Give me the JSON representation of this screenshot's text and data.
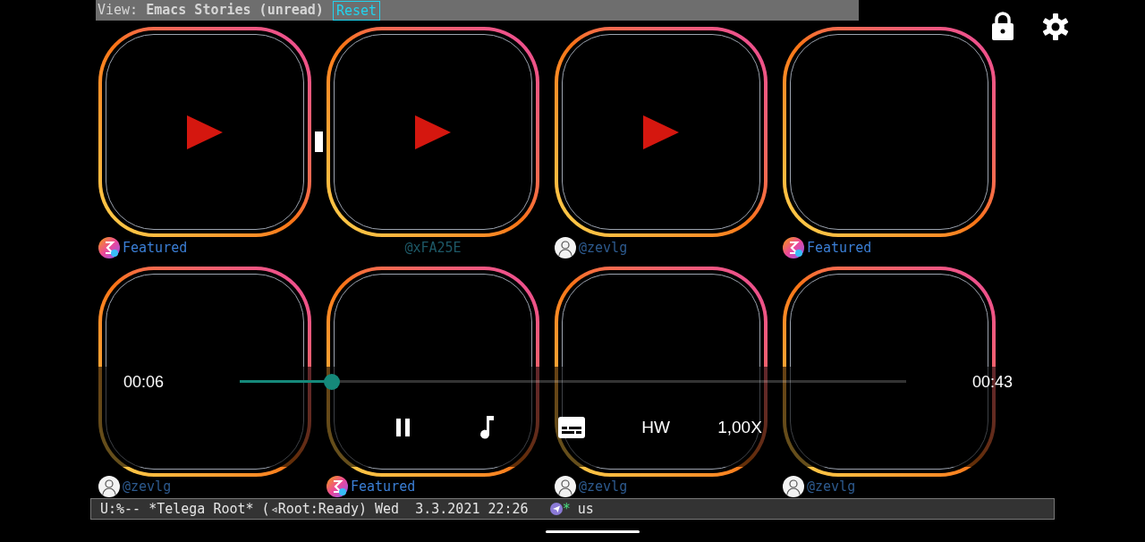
{
  "header": {
    "view_label": "View: **Emacs Stories (unread)**",
    "reset_button": "Reset"
  },
  "stories": [
    {
      "has_play": true,
      "kind": "featured",
      "author": "Featured",
      "color": "#3b7fd6"
    },
    {
      "has_play": true,
      "kind": "plain",
      "author": "@xFA25E",
      "color": "#1d5866"
    },
    {
      "has_play": true,
      "kind": "person",
      "author": "@zevlg",
      "color": "#2d5a8e"
    },
    {
      "has_play": false,
      "kind": "featured",
      "author": "Featured",
      "color": "#3b7fd6"
    },
    {
      "has_play": false,
      "kind": "person",
      "author": "@zevlg",
      "color": "#2d5a8e"
    },
    {
      "has_play": false,
      "kind": "featured",
      "author": "Featured",
      "color": "#3b7fd6"
    },
    {
      "has_play": false,
      "kind": "person",
      "author": "@zevlg",
      "color": "#2d5a8e"
    },
    {
      "has_play": false,
      "kind": "person",
      "author": "@zevlg",
      "color": "#2d5a8e"
    }
  ],
  "player": {
    "elapsed": "00:06",
    "total": "00:43",
    "level": 0.138,
    "playing": true,
    "decoder": "HW",
    "speed": "1,00X"
  },
  "mode_line": {
    "status": "U:%-- *Telega Root* (◃Root:Ready) Wed  3.3.2021 22:26",
    "flag": "*",
    "input_method": "us"
  }
}
